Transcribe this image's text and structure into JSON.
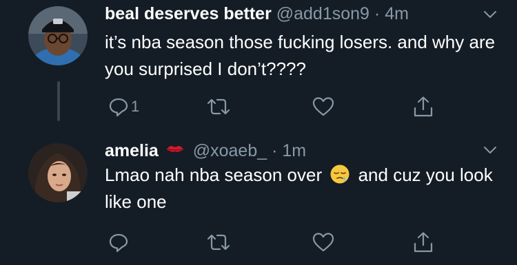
{
  "tweets": [
    {
      "name": "beal deserves better",
      "handle": "@add1son9",
      "separator": "·",
      "time": "4m",
      "text": "it’s nba season those fucking losers. and why are you surprised I don’t????",
      "reply_count": "1",
      "avatar_icon": "avatar-person-cap-glasses"
    },
    {
      "name": "amelia",
      "name_emoji": "kiss-mark-emoji",
      "handle": "@xoaeb_",
      "separator": "·",
      "time": "1m",
      "text_before_emoji": "Lmao nah nba season over",
      "inline_emoji": "sleepy-face-emoji",
      "text_after_emoji": "and cuz you look like one",
      "reply_count": "",
      "avatar_icon": "avatar-person-long-hair"
    }
  ],
  "colors": {
    "background": "#141d26",
    "text": "#ffffff",
    "secondary": "#8899a6",
    "thread_line": "#3a4450"
  }
}
